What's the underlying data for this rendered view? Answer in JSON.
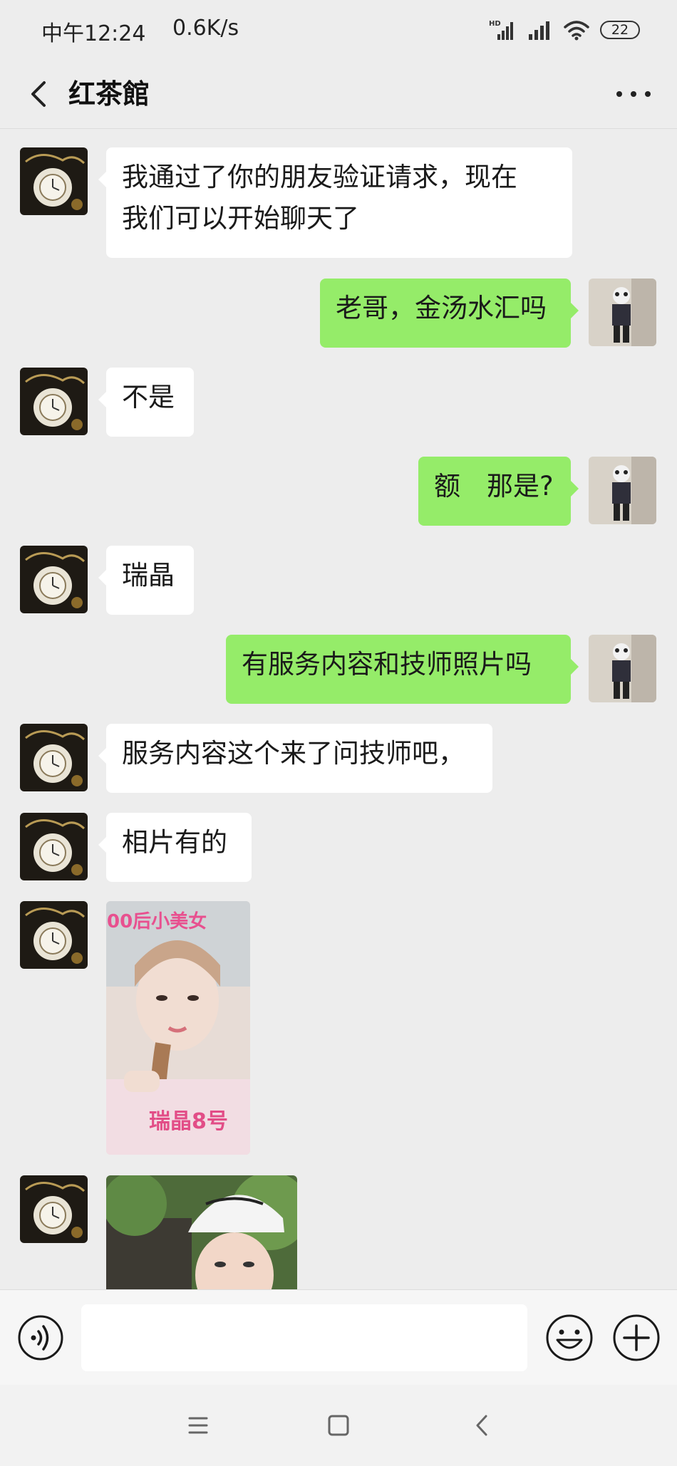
{
  "status_bar": {
    "time": "中午12:24",
    "speed": "0.6K/s",
    "network_label": "HD",
    "battery": "22"
  },
  "header": {
    "back_icon": "chevron-left-icon",
    "title": "红茶館",
    "more_icon": "more-horizontal-icon"
  },
  "messages": [
    {
      "from": "contact",
      "type": "text",
      "text": "我通过了你的朋友验证请求，现在\n我们可以开始聊天了"
    },
    {
      "from": "me",
      "type": "text",
      "text": "老哥，金汤水汇吗"
    },
    {
      "from": "contact",
      "type": "text",
      "text": "不是"
    },
    {
      "from": "me",
      "type": "text",
      "text": "额　那是?"
    },
    {
      "from": "contact",
      "type": "text",
      "text": "瑞晶"
    },
    {
      "from": "me",
      "type": "text",
      "text": "有服务内容和技师照片吗"
    },
    {
      "from": "contact",
      "type": "text",
      "text": "服务内容这个来了问技师吧，"
    },
    {
      "from": "contact",
      "type": "text",
      "text": "相片有的"
    },
    {
      "from": "contact",
      "type": "image",
      "caption_top": "00后小美女",
      "caption_bottom": "瑞晶8号"
    },
    {
      "from": "contact",
      "type": "image"
    }
  ],
  "input_bar": {
    "voice_icon": "voice-icon",
    "placeholder": "",
    "emoji_icon": "emoji-icon",
    "plus_icon": "plus-circle-icon"
  },
  "nav_bar": {
    "menu_icon": "menu-icon",
    "home_icon": "home-square-icon",
    "back_icon": "back-triangle-icon"
  },
  "colors": {
    "background": "#ededed",
    "outgoing_bubble": "#95ec69",
    "incoming_bubble": "#ffffff",
    "caption_pink": "#e8508f"
  }
}
